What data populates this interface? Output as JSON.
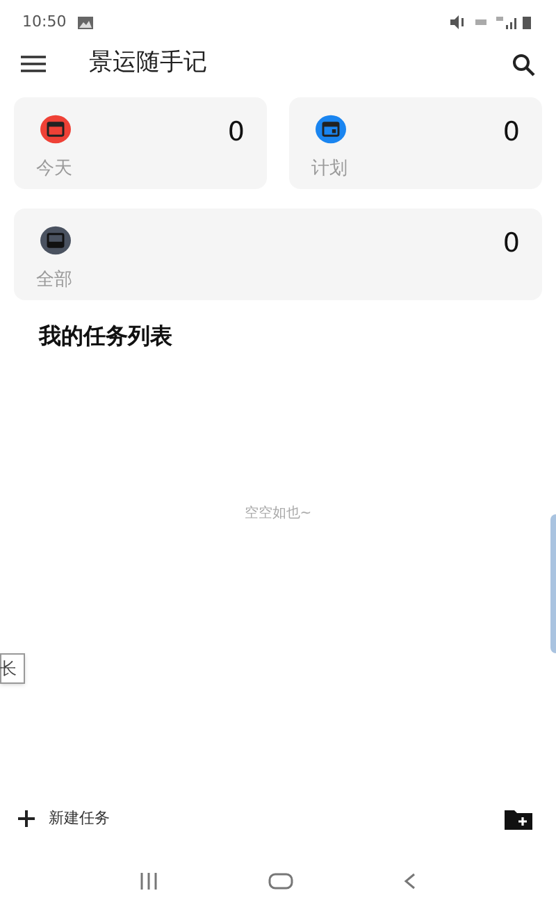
{
  "status_bar": {
    "time": "10:50"
  },
  "app_bar": {
    "title": "景运随手记"
  },
  "cards": [
    {
      "label": "今天",
      "count": "0",
      "color": "#ef4136",
      "kind": "today"
    },
    {
      "label": "计划",
      "count": "0",
      "color": "#1a85f0",
      "kind": "scheduled"
    },
    {
      "label": "全部",
      "count": "0",
      "color": "#4a5260",
      "kind": "all"
    }
  ],
  "list_section": {
    "title": "我的任务列表",
    "empty_text": "空空如也~"
  },
  "floating_tab": {
    "label": "长"
  },
  "bottom_bar": {
    "new_task": "新建任务"
  }
}
